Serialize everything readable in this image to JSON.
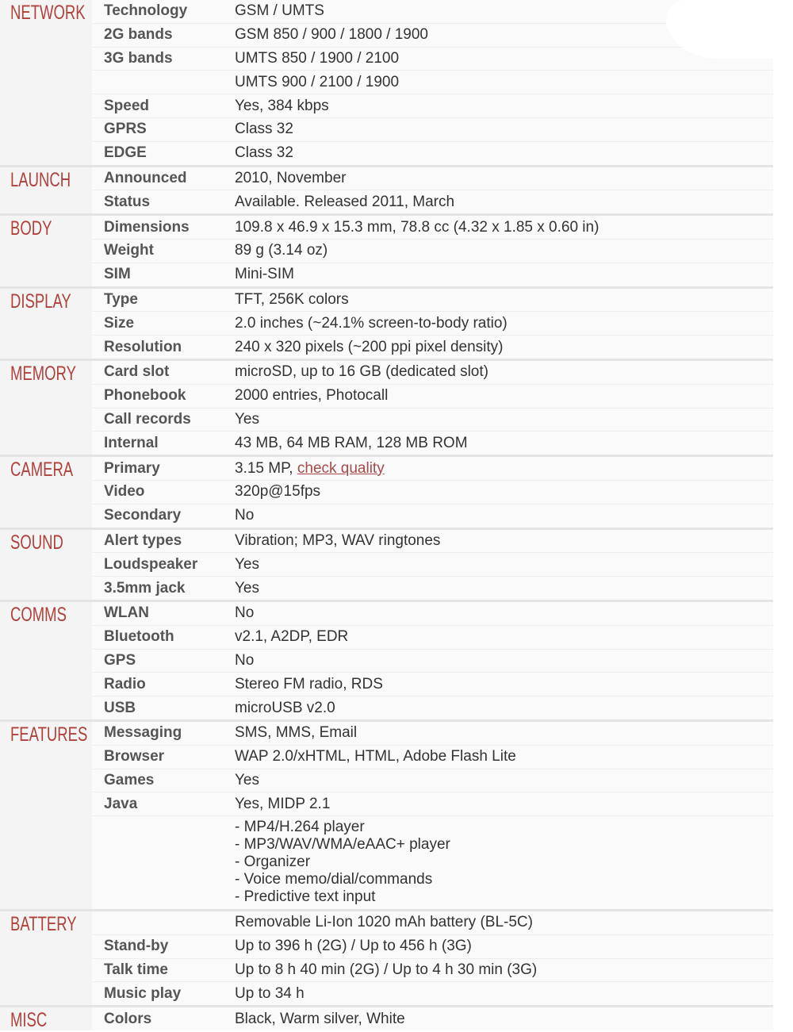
{
  "accent_color": "#b0403b",
  "sections": [
    {
      "name": "NETWORK",
      "rows": [
        {
          "title": "Technology",
          "value": "GSM / UMTS"
        },
        {
          "title": "2G bands",
          "value": "GSM 850 / 900 / 1800 / 1900"
        },
        {
          "title": "3G bands",
          "value": "UMTS 850 / 1900 / 2100"
        },
        {
          "title": "",
          "value": "UMTS 900 / 2100 / 1900"
        },
        {
          "title": "Speed",
          "value": "Yes, 384 kbps"
        },
        {
          "title": "GPRS",
          "value": "Class 32"
        },
        {
          "title": "EDGE",
          "value": "Class 32"
        }
      ]
    },
    {
      "name": "LAUNCH",
      "rows": [
        {
          "title": "Announced",
          "value": "2010, November"
        },
        {
          "title": "Status",
          "value": "Available. Released 2011, March"
        }
      ]
    },
    {
      "name": "BODY",
      "rows": [
        {
          "title": "Dimensions",
          "value": "109.8 x 46.9 x 15.3 mm, 78.8 cc (4.32 x 1.85 x 0.60 in)"
        },
        {
          "title": "Weight",
          "value": "89 g (3.14 oz)"
        },
        {
          "title": "SIM",
          "value": "Mini-SIM"
        }
      ]
    },
    {
      "name": "DISPLAY",
      "rows": [
        {
          "title": "Type",
          "value": "TFT, 256K colors"
        },
        {
          "title": "Size",
          "value": "2.0 inches (~24.1% screen-to-body ratio)"
        },
        {
          "title": "Resolution",
          "value": "240 x 320 pixels (~200 ppi pixel density)"
        }
      ]
    },
    {
      "name": "MEMORY",
      "rows": [
        {
          "title": "Card slot",
          "value": "microSD, up to 16 GB (dedicated slot)"
        },
        {
          "title": "Phonebook",
          "value": "2000 entries, Photocall"
        },
        {
          "title": "Call records",
          "value": "Yes"
        },
        {
          "title": "Internal",
          "value": "43 MB, 64 MB RAM, 128 MB ROM"
        }
      ]
    },
    {
      "name": "CAMERA",
      "rows": [
        {
          "title": "Primary",
          "value": "3.15 MP, ",
          "link": "check quality"
        },
        {
          "title": "Video",
          "value": "320p@15fps"
        },
        {
          "title": "Secondary",
          "value": "No"
        }
      ]
    },
    {
      "name": "SOUND",
      "rows": [
        {
          "title": "Alert types",
          "value": "Vibration; MP3, WAV ringtones"
        },
        {
          "title": "Loudspeaker",
          "value": "Yes"
        },
        {
          "title": "3.5mm jack",
          "value": "Yes"
        }
      ]
    },
    {
      "name": "COMMS",
      "rows": [
        {
          "title": "WLAN",
          "value": "No"
        },
        {
          "title": "Bluetooth",
          "value": "v2.1, A2DP, EDR"
        },
        {
          "title": "GPS",
          "value": "No"
        },
        {
          "title": "Radio",
          "value": "Stereo FM radio, RDS"
        },
        {
          "title": "USB",
          "value": "microUSB v2.0"
        }
      ]
    },
    {
      "name": "FEATURES",
      "rows": [
        {
          "title": "Messaging",
          "value": "SMS, MMS, Email"
        },
        {
          "title": "Browser",
          "value": "WAP 2.0/xHTML, HTML, Adobe Flash Lite"
        },
        {
          "title": "Games",
          "value": "Yes"
        },
        {
          "title": "Java",
          "value": "Yes, MIDP 2.1"
        },
        {
          "title": "",
          "value": "- MP4/H.264 player\n- MP3/WAV/WMA/eAAC+ player\n- Organizer\n- Voice memo/dial/commands\n- Predictive text input",
          "multiline": true
        }
      ]
    },
    {
      "name": "BATTERY",
      "rows": [
        {
          "title": "",
          "value": "Removable Li-Ion 1020 mAh battery (BL-5C)"
        },
        {
          "title": "Stand-by",
          "value": "Up to 396 h (2G) / Up to 456 h (3G)"
        },
        {
          "title": "Talk time",
          "value": "Up to 8 h 40 min (2G) / Up to 4 h 30 min (3G)"
        },
        {
          "title": "Music play",
          "value": "Up to 34 h"
        }
      ]
    },
    {
      "name": "MISC",
      "rows": [
        {
          "title": "Colors",
          "value": "Black, Warm silver, White"
        }
      ]
    }
  ]
}
